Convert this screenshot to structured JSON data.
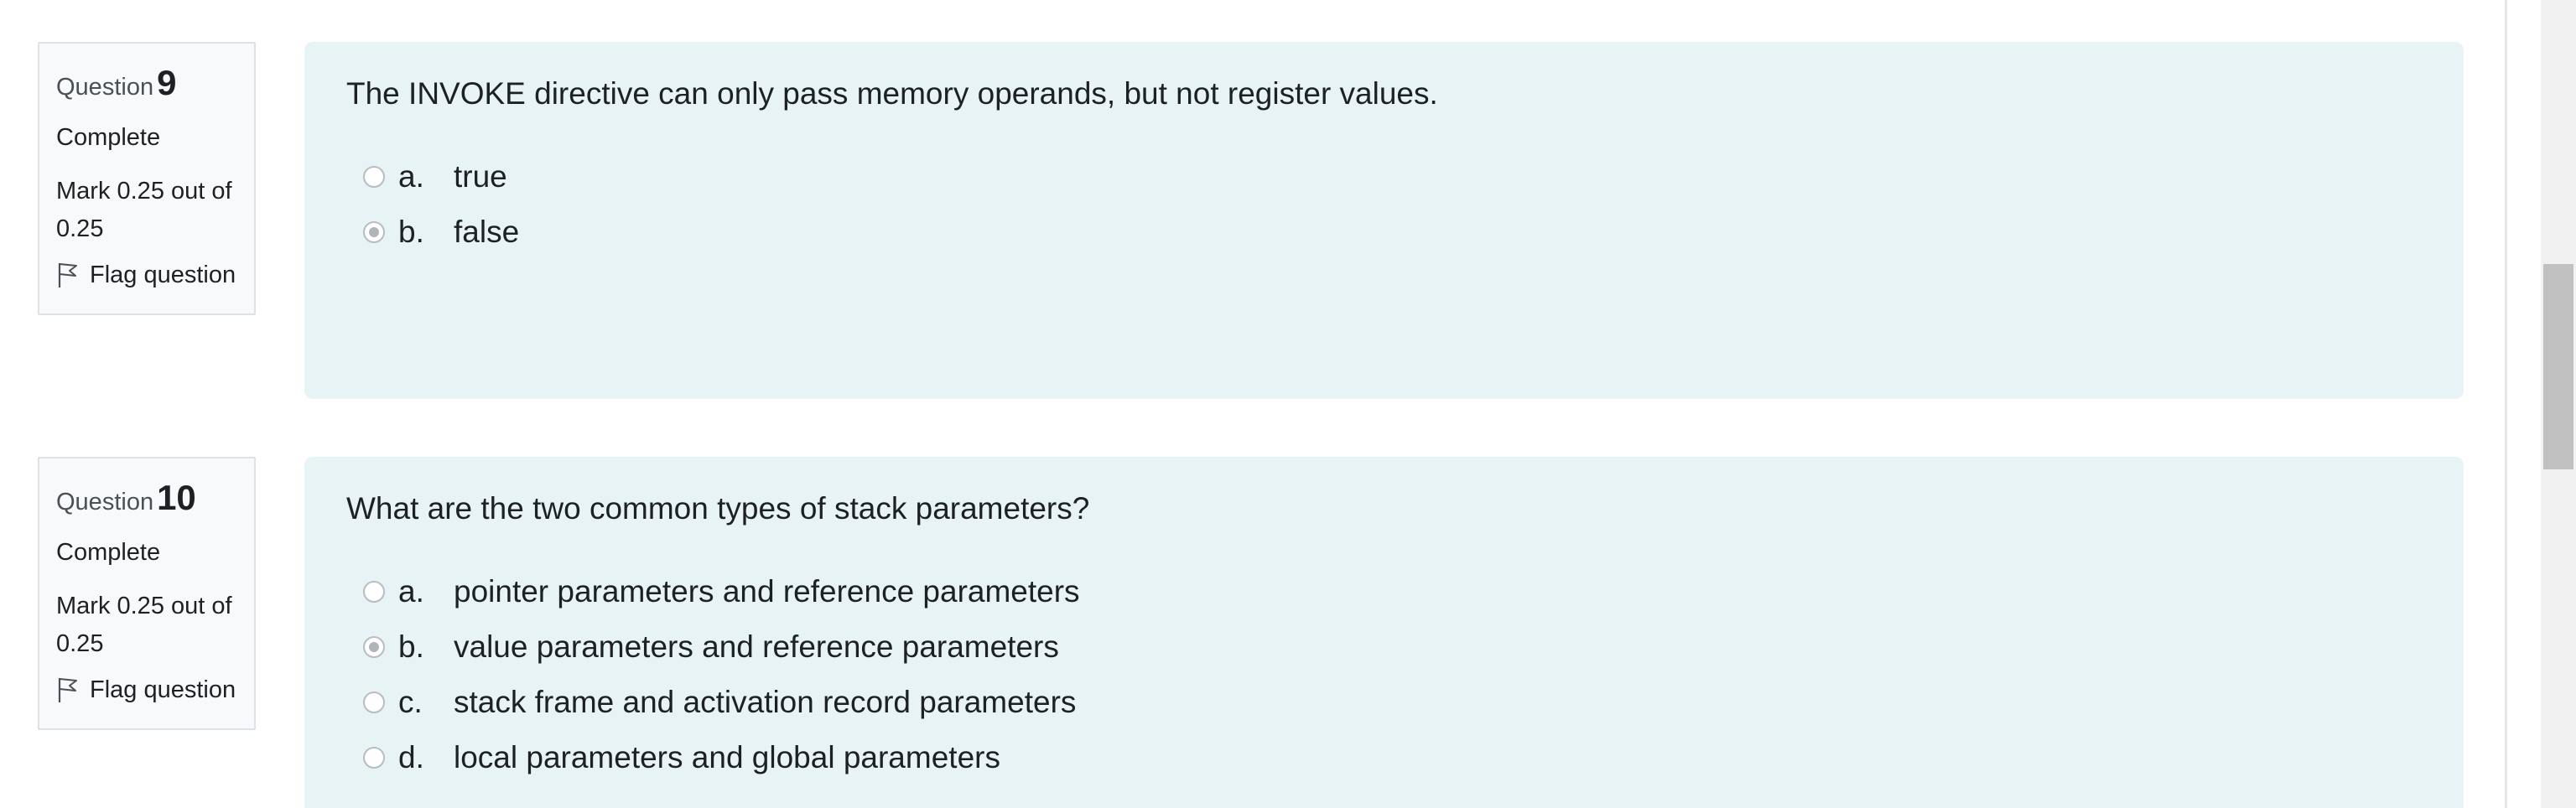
{
  "questions": [
    {
      "label": "Question",
      "number": "9",
      "state": "Complete",
      "grade_line1": "Mark 0.25 out of",
      "grade_line2": "0.25",
      "flag_label": "Flag question",
      "text": "The INVOKE directive can only pass memory operands, but not register values.",
      "answers": [
        {
          "letter": "a.",
          "text": "true",
          "selected": false
        },
        {
          "letter": "b.",
          "text": "false",
          "selected": true
        }
      ]
    },
    {
      "label": "Question",
      "number": "10",
      "state": "Complete",
      "grade_line1": "Mark 0.25 out of",
      "grade_line2": "0.25",
      "flag_label": "Flag question",
      "text": "What are the two common types of stack parameters?",
      "answers": [
        {
          "letter": "a.",
          "text": "pointer parameters and reference parameters",
          "selected": false
        },
        {
          "letter": "b.",
          "text": "value parameters and reference parameters",
          "selected": true
        },
        {
          "letter": "c.",
          "text": "stack frame and activation record parameters",
          "selected": false
        },
        {
          "letter": "d.",
          "text": "local parameters and global parameters",
          "selected": false
        }
      ]
    }
  ],
  "icons": {
    "flag": "flag-icon"
  }
}
